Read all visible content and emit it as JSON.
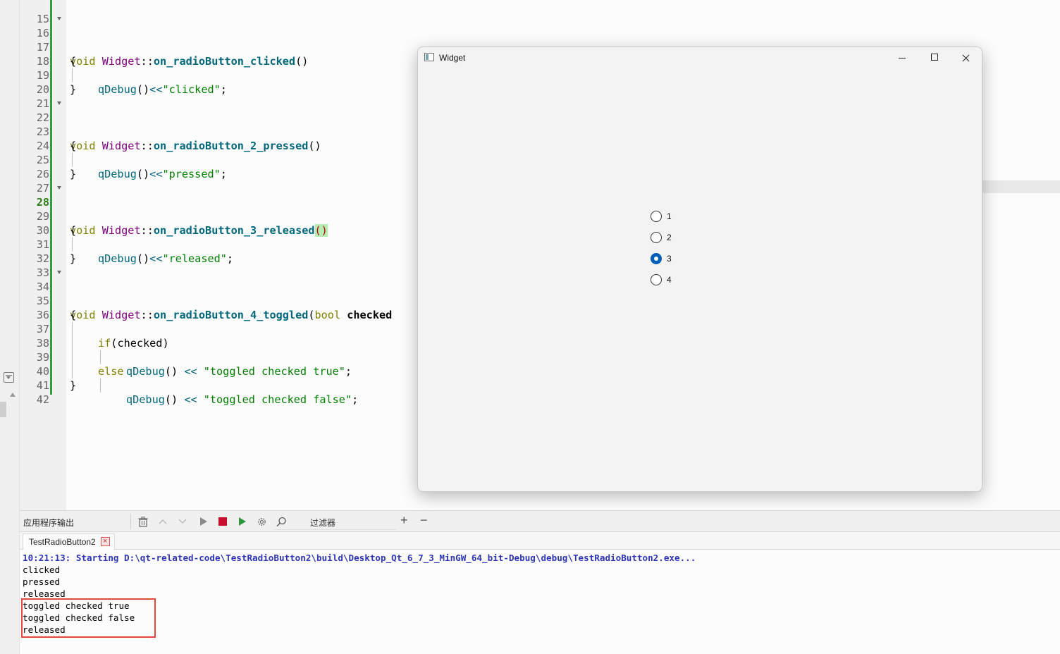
{
  "editor": {
    "lines": [
      {
        "n": "15"
      },
      {
        "n": "16"
      },
      {
        "n": "17"
      },
      {
        "n": "18"
      },
      {
        "n": "19"
      },
      {
        "n": "20"
      },
      {
        "n": "21"
      },
      {
        "n": "22"
      },
      {
        "n": "23"
      },
      {
        "n": "24"
      },
      {
        "n": "25"
      },
      {
        "n": "26"
      },
      {
        "n": "27"
      },
      {
        "n": "28"
      },
      {
        "n": "29"
      },
      {
        "n": "30"
      },
      {
        "n": "31"
      },
      {
        "n": "32"
      },
      {
        "n": "33"
      },
      {
        "n": "34"
      },
      {
        "n": "35"
      },
      {
        "n": "36"
      },
      {
        "n": "37"
      },
      {
        "n": "38"
      },
      {
        "n": "39"
      },
      {
        "n": "40"
      },
      {
        "n": "41"
      },
      {
        "n": "42"
      }
    ],
    "code": {
      "kw_void": "void",
      "cls_widget": "Widget",
      "scope": "::",
      "fn_clicked": "on_radioButton_clicked",
      "fn_pressed": "on_radioButton_2_pressed",
      "fn_released": "on_radioButton_3_released",
      "fn_toggled": "on_radioButton_4_toggled",
      "empty_parens": "()",
      "open_paren": "(",
      "kw_bool": "bool",
      "param_checked": "checked",
      "open_brace": "{",
      "close_brace": "}",
      "call_qdebug": "qDebug",
      "op_shift": "<<",
      "op_shift_spaced": " << ",
      "str_clicked": "\"clicked\"",
      "str_pressed": "\"pressed\"",
      "str_released": "\"released\"",
      "str_true": "\"toggled checked true\"",
      "str_false": "\"toggled checked false\"",
      "semicolon": ";",
      "kw_if": "if",
      "if_cond": "(checked)",
      "kw_else": "else"
    }
  },
  "output": {
    "title": "应用程序输出",
    "filter_label": "过滤器",
    "tab_label": "TestRadioButton2",
    "lines": [
      "10:21:13: Starting D:\\qt-related-code\\TestRadioButton2\\build\\Desktop_Qt_6_7_3_MinGW_64_bit-Debug\\debug\\TestRadioButton2.exe...",
      "clicked",
      "pressed",
      "released",
      "toggled checked true",
      "toggled checked false",
      "released"
    ]
  },
  "widget_window": {
    "title": "Widget",
    "radios": [
      {
        "label": "1",
        "checked": false
      },
      {
        "label": "2",
        "checked": false
      },
      {
        "label": "3",
        "checked": true
      },
      {
        "label": "4",
        "checked": false
      }
    ]
  },
  "colors": {
    "accent": "#005fb8",
    "highlight_box": "#e8473c",
    "gutter_change": "#2ea043",
    "stop": "#c8102e"
  }
}
